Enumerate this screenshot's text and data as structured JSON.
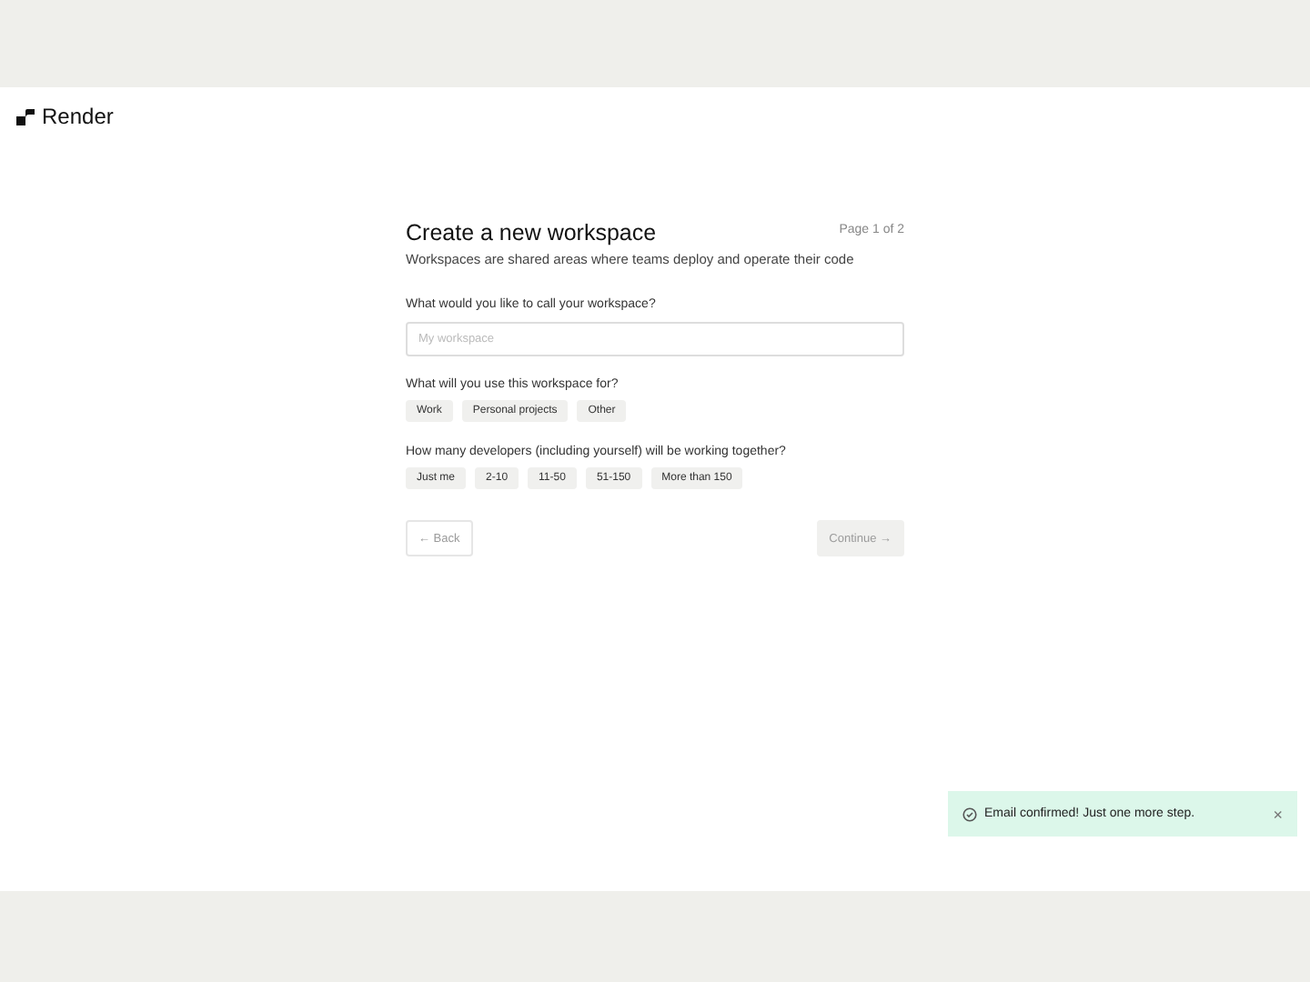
{
  "brand": {
    "name": "Render"
  },
  "form": {
    "title": "Create a new workspace",
    "page": "Page 1 of 2",
    "subtitle": "Workspaces are shared areas where teams deploy and operate their code",
    "name_question": "What would you like to call your workspace?",
    "name_field": {
      "placeholder": "My workspace"
    },
    "use_question": "What will you use this workspace for?",
    "use_options": [
      {
        "label": "Work",
        "selected": false
      },
      {
        "label": "Personal projects",
        "selected": false
      },
      {
        "label": "Other",
        "selected": false
      }
    ],
    "size_question": "How many developers (including yourself) will be working together?",
    "size_options": [
      {
        "label": "Just me",
        "selected": false
      },
      {
        "label": "2-10",
        "selected": false
      },
      {
        "label": "11-50",
        "selected": false
      },
      {
        "label": "51-150",
        "selected": false
      },
      {
        "label": "More than 150",
        "selected": false
      }
    ],
    "back": {
      "label": "← Back",
      "disabled": true
    },
    "continue": {
      "label": "Continue →",
      "disabled": true
    }
  },
  "toast": {
    "message": "Email confirmed! Just one more step.",
    "close": "×"
  }
}
